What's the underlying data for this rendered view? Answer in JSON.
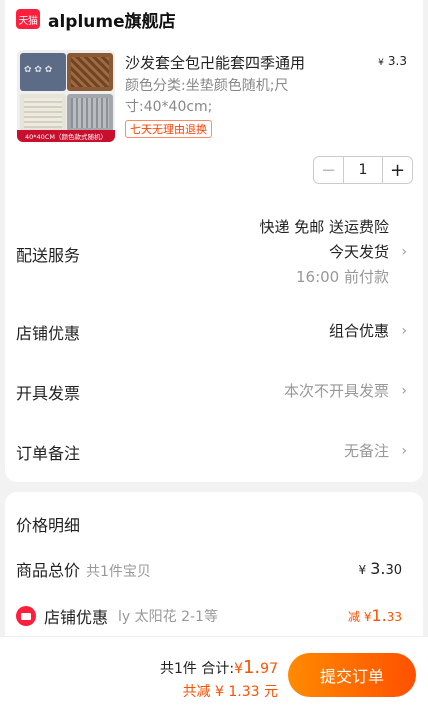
{
  "shop": {
    "badge": "天猫",
    "name": "alplume旗舰店",
    "brand_color": "#ff1f3d"
  },
  "product": {
    "image_caption": "40*40CM（颜色款式随机）",
    "title": "沙发套全包卍能套四季通用",
    "unit_symbol": "¥",
    "price": "3.3",
    "variant": "颜色分类:坐垫颜色随机;尺寸:40*40cm;",
    "return_tag": "七天无理由退换",
    "quantity": "1",
    "minus": "−",
    "plus": "+"
  },
  "delivery": {
    "label": "配送服务",
    "line1": "快递 免邮 送运费险",
    "line2": "今天发货",
    "line3": "16:00 前付款"
  },
  "rows": {
    "coupon_label": "店铺优惠",
    "coupon_value": "组合优惠",
    "invoice_label": "开具发票",
    "invoice_value": "本次不开具发票",
    "note_label": "订单备注",
    "note_value": "无备注",
    "chevron": "›"
  },
  "price_detail": {
    "title": "价格明细",
    "total_label": "商品总价",
    "total_count": "共1件宝贝",
    "total_symbol": "¥",
    "total_int": "3.",
    "total_dec": "30",
    "discount_label": "店铺优惠",
    "discount_sub": "ly 太阳花 2-1等",
    "discount_prefix": "减 ¥",
    "discount_int": "1.",
    "discount_dec": "33",
    "accent_color": "#ff5000"
  },
  "bottom": {
    "count_text": "共1件 合计:",
    "total_symbol": "¥",
    "total_int": "1.",
    "total_dec": "97",
    "saved_text": "共减 ¥ 1.33 元",
    "submit_label": "提交订单"
  }
}
